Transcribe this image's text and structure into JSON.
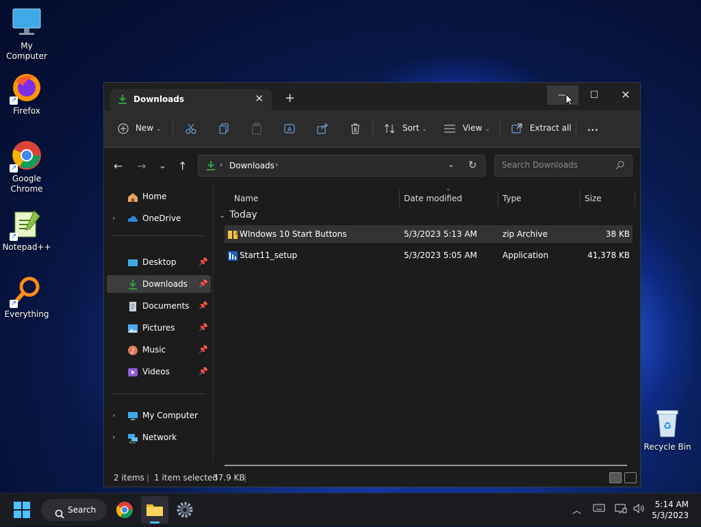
{
  "desktop": {
    "icons": [
      {
        "label": "My Computer",
        "icon": "monitor-icon"
      },
      {
        "label": "Firefox",
        "icon": "firefox-icon"
      },
      {
        "label": "Google Chrome",
        "icon": "chrome-icon"
      },
      {
        "label": "Notepad++",
        "icon": "notepadpp-icon"
      },
      {
        "label": "Everything",
        "icon": "magnifier-icon"
      },
      {
        "label": "Recycle Bin",
        "icon": "recycle-bin-icon"
      }
    ]
  },
  "window": {
    "tab_title": "Downloads",
    "toolbar": {
      "new_label": "New",
      "sort_label": "Sort",
      "view_label": "View",
      "extract_label": "Extract all",
      "more_label": "..."
    },
    "address": {
      "crumb": "Downloads",
      "search_placeholder": "Search Downloads"
    },
    "sidebar": {
      "items": [
        {
          "label": "Home",
          "icon": "home-icon"
        },
        {
          "label": "OneDrive",
          "icon": "cloud-icon"
        },
        {
          "label": "Desktop",
          "icon": "desktop-icon"
        },
        {
          "label": "Downloads",
          "icon": "download-icon"
        },
        {
          "label": "Documents",
          "icon": "document-icon"
        },
        {
          "label": "Pictures",
          "icon": "picture-icon"
        },
        {
          "label": "Music",
          "icon": "music-icon"
        },
        {
          "label": "Videos",
          "icon": "video-icon"
        },
        {
          "label": "My Computer",
          "icon": "monitor-icon"
        },
        {
          "label": "Network",
          "icon": "network-icon"
        }
      ]
    },
    "columns": [
      "Name",
      "Date modified",
      "Type",
      "Size"
    ],
    "group_label": "Today",
    "files": [
      {
        "name": "WIndows 10 Start Buttons",
        "date": "5/3/2023 5:13 AM",
        "type": "zip Archive",
        "size": "38 KB",
        "selected": true
      },
      {
        "name": "Start11_setup",
        "date": "5/3/2023 5:05 AM",
        "type": "Application",
        "size": "41,378 KB",
        "selected": false
      }
    ],
    "status": {
      "count": "2 items",
      "selection": "1 item selected",
      "selection_size": "37.9 KB"
    }
  },
  "taskbar": {
    "search_label": "Search",
    "time": "5:14 AM",
    "date": "5/3/2023"
  },
  "colors": {
    "window_bg": "#1c1c1c",
    "toolbar_bg": "#2c2c2c",
    "accent_download": "#2ea043"
  }
}
